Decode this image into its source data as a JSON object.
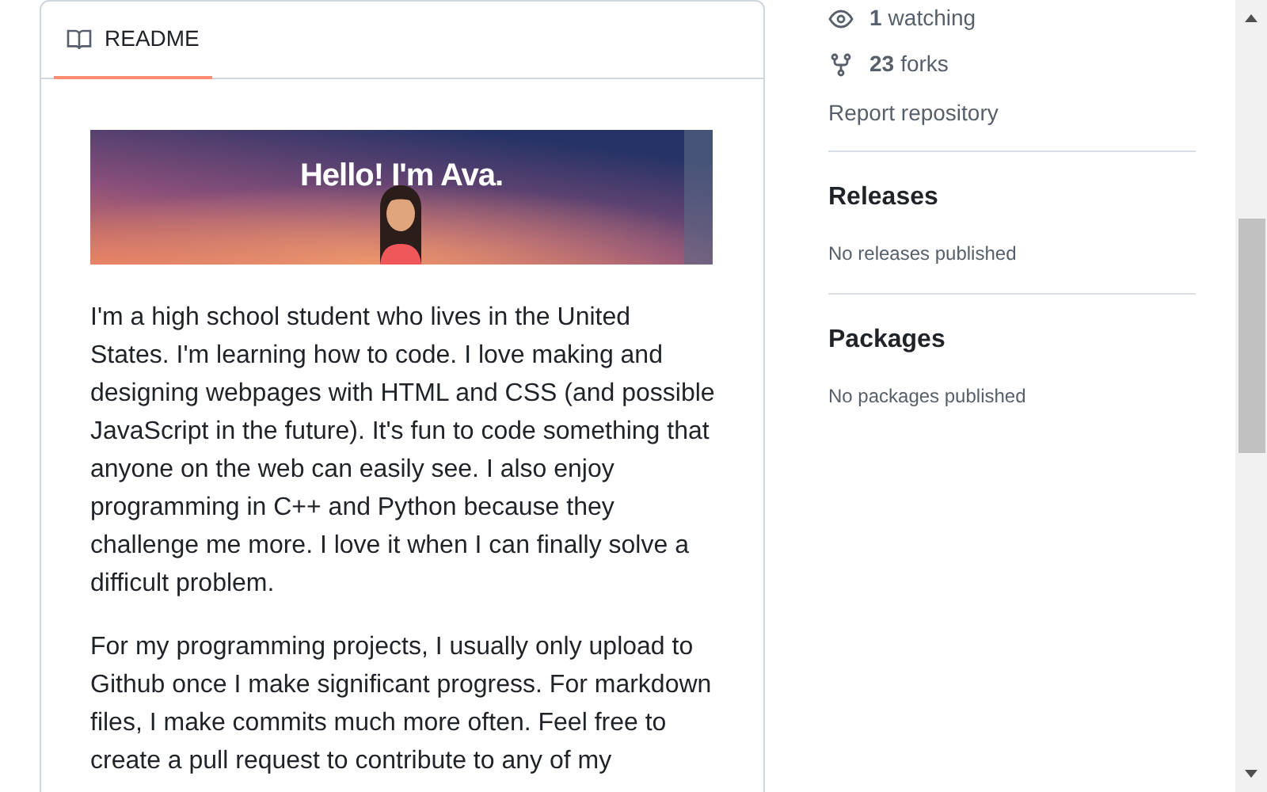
{
  "readme": {
    "tab": {
      "label": "README",
      "selected": true
    },
    "banner": {
      "heading": "Hello! I'm Ava."
    },
    "paragraphs": [
      "I'm a high school student who lives in the United States. I'm learning how to code. I love making and designing webpages with HTML and CSS (and possible JavaScript in the future). It's fun to code something that anyone on the web can easily see. I also enjoy programming in C++ and Python because they challenge me more. I love it when I can finally solve a difficult problem.",
      "For my programming projects, I usually only upload to Github once I make significant progress. For markdown files, I make commits much more often. Feel free to create a pull request to contribute to any of my"
    ]
  },
  "sidebar": {
    "stats": [
      {
        "kind": "watching",
        "count": "1",
        "label": "watching"
      },
      {
        "kind": "forks",
        "count": "23",
        "label": "forks"
      }
    ],
    "report_link": "Report repository",
    "sections": [
      {
        "title": "Releases",
        "note": "No releases published"
      },
      {
        "title": "Packages",
        "note": "No packages published"
      }
    ]
  }
}
